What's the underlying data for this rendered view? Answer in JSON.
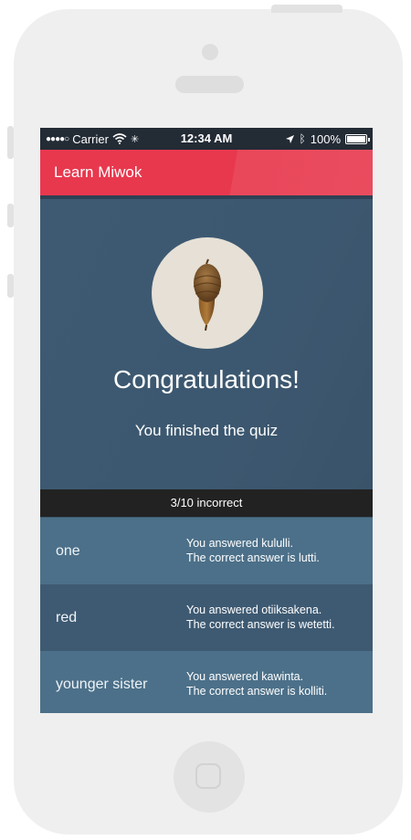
{
  "status_bar": {
    "carrier": "Carrier",
    "time": "12:34 AM",
    "battery": "100%"
  },
  "app_bar": {
    "title": "Learn Miwok",
    "color": "#e8384e"
  },
  "hero": {
    "image": "acorn",
    "title": "Congratulations!",
    "subtitle": "You finished the quiz"
  },
  "score": {
    "text": "3/10 incorrect"
  },
  "results": [
    {
      "word": "one",
      "answered": "You answered kululli.",
      "correct": "The correct answer is lutti."
    },
    {
      "word": "red",
      "answered": "You answered otiiksakena.",
      "correct": "The correct answer is wetetti."
    },
    {
      "word": "younger sister",
      "answered": "You answered kawinta.",
      "correct": "The correct answer is kolliti."
    }
  ],
  "colors": {
    "background": "#3b556c",
    "row_light": "#4c7089",
    "row_dark": "#3e5a72",
    "score_bar": "#222222"
  }
}
